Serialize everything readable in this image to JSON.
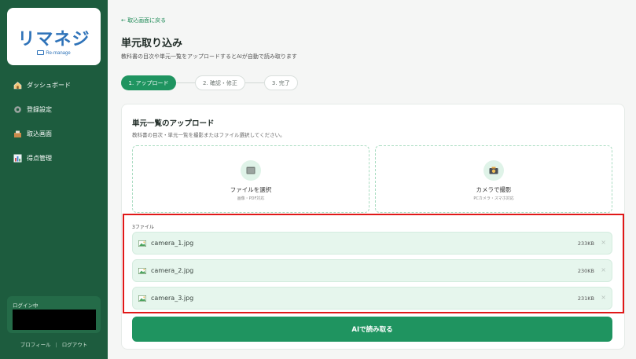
{
  "sidebar": {
    "logo": {
      "main": "リマネジ",
      "sub": "Re-manage"
    },
    "items": [
      {
        "label": "ダッシュボード",
        "icon": "house-icon"
      },
      {
        "label": "登録設定",
        "icon": "gear-icon"
      },
      {
        "label": "取込画面",
        "icon": "inbox-tray-icon"
      },
      {
        "label": "得点管理",
        "icon": "bar-chart-icon"
      }
    ],
    "login_label": "ログイン中",
    "links": {
      "profile": "プロフィール",
      "separator": "|",
      "logout": "ログアウト"
    }
  },
  "header": {
    "back_link": "← 取込画面に戻る",
    "title": "単元取り込み",
    "subtitle": "教科書の目次や単元一覧をアップロードするとAIが自動で読み取ります"
  },
  "steps": [
    {
      "label": "1. アップロード",
      "state": "active"
    },
    {
      "label": "2. 確認・修正",
      "state": "inactive"
    },
    {
      "label": "3. 完了",
      "state": "inactive"
    }
  ],
  "upload": {
    "title": "単元一覧のアップロード",
    "subtitle": "教科書の目次・単元一覧を撮影またはファイル選択してください。",
    "file_option": {
      "title": "ファイルを選択",
      "note": "画像・PDF対応",
      "icon": "folder-icon"
    },
    "camera_option": {
      "title": "カメラで撮影",
      "note": "PCカメラ・スマホ対応",
      "icon": "camera-icon"
    },
    "file_count": "3ファイル",
    "files": [
      {
        "name": "camera_1.jpg",
        "size": "233KB",
        "remove": "×"
      },
      {
        "name": "camera_2.jpg",
        "size": "230KB",
        "remove": "×"
      },
      {
        "name": "camera_3.jpg",
        "size": "231KB",
        "remove": "×"
      }
    ],
    "submit_label": "AIで読み取る"
  },
  "colors": {
    "sidebar": "#1d5c3e",
    "accent": "#1f9460",
    "highlight": "#e01818"
  }
}
